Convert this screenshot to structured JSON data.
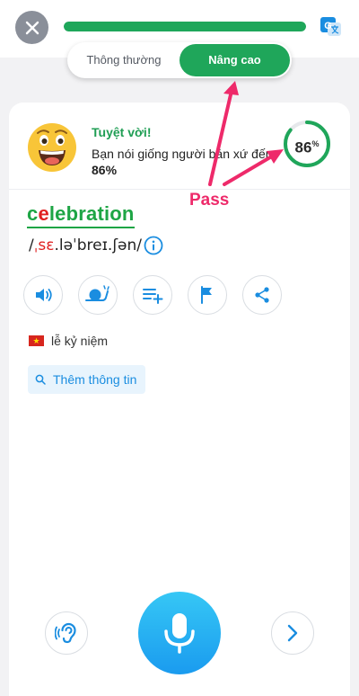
{
  "header": {
    "progress_percent": 100,
    "colors": {
      "progress_fill": "#1ea75a",
      "progress_track": "#e6e8eb",
      "close_bg": "#8a8f99"
    }
  },
  "mode_switch": {
    "options": [
      {
        "label": "Thông thường",
        "selected": false
      },
      {
        "label": "Nâng cao",
        "selected": true
      }
    ],
    "accent": "#1fa65a"
  },
  "result": {
    "title": "Tuyệt vời!",
    "message_prefix": "Bạn nói giống người bản xứ đến",
    "score_label": "86%",
    "score_number": "86",
    "score_unit": "%",
    "score_value": 86
  },
  "word": {
    "text_part1": "c",
    "text_bad": "e",
    "text_part2": "lebration",
    "ipa_prefix": "/",
    "ipa_bad": "ˌsɛ",
    "ipa_rest": ".ləˈbreɪ.ʃən/",
    "colors": {
      "good": "#1ea545",
      "bad": "#e02020"
    }
  },
  "actions": [
    {
      "icon": "speaker-icon"
    },
    {
      "icon": "slow-snail-icon"
    },
    {
      "icon": "add-to-list-icon"
    },
    {
      "icon": "flag-icon"
    },
    {
      "icon": "share-icon"
    }
  ],
  "meaning": {
    "flag_icon": "vietnam-flag-icon",
    "text": "lễ kỷ niệm"
  },
  "more_info": {
    "label": "Thêm thông tin",
    "icon": "search-icon"
  },
  "bottom": {
    "listen_icon": "ear-icon",
    "record_icon": "microphone-icon",
    "next_icon": "chevron-right-icon"
  },
  "annotation": {
    "label": "Pass",
    "color": "#ee2a6a"
  }
}
